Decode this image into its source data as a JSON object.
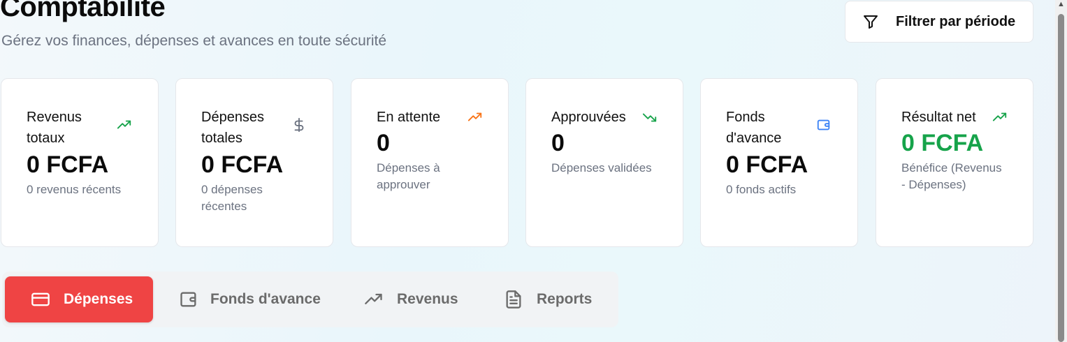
{
  "header": {
    "title": "Comptabilité",
    "subtitle": "Gérez vos finances, dépenses et avances en toute sécurité",
    "filter_label": "Filtrer par période"
  },
  "cards": [
    {
      "title": "Revenus totaux",
      "value": "0 FCFA",
      "desc": "0 revenus récents",
      "icon": "trending-up-icon",
      "icon_color": "#16a34a"
    },
    {
      "title": "Dépenses totales",
      "value": "0 FCFA",
      "desc": "0 dépenses récentes",
      "icon": "dollar-icon",
      "icon_color": "#6b7280"
    },
    {
      "title": "En attente",
      "value": "0",
      "desc": "Dépenses à approuver",
      "icon": "trending-up-icon",
      "icon_color": "#f97316"
    },
    {
      "title": "Approuvées",
      "value": "0",
      "desc": "Dépenses validées",
      "icon": "trending-down-icon",
      "icon_color": "#16a34a"
    },
    {
      "title": "Fonds d'avance",
      "value": "0 FCFA",
      "desc": "0 fonds actifs",
      "icon": "wallet-icon",
      "icon_color": "#3b82f6"
    },
    {
      "title": "Résultat net",
      "value": "0 FCFA",
      "desc": "Bénéfice (Revenus - Dépenses)",
      "icon": "trending-up-icon",
      "icon_color": "#16a34a",
      "value_color": "#16a34a"
    }
  ],
  "tabs": [
    {
      "label": "Dépenses",
      "icon": "credit-card-icon",
      "active": true
    },
    {
      "label": "Fonds d'avance",
      "icon": "wallet-icon",
      "active": false
    },
    {
      "label": "Revenus",
      "icon": "trending-up-icon",
      "active": false
    },
    {
      "label": "Reports",
      "icon": "file-text-icon",
      "active": false
    }
  ],
  "colors": {
    "accent_red": "#ef4444",
    "positive_green": "#16a34a",
    "warning_orange": "#f97316",
    "info_blue": "#3b82f6"
  }
}
